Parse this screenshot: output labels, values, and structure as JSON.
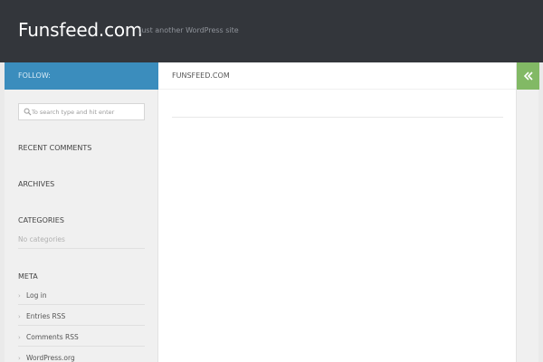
{
  "header": {
    "site_title": "Funsfeed.com",
    "site_description": "Just another WordPress site"
  },
  "sidebar": {
    "follow_label": "FOLLOW:",
    "search": {
      "placeholder": "To search type and hit enter"
    },
    "widgets": {
      "recent_comments": "RECENT COMMENTS",
      "archives": "ARCHIVES",
      "categories": "CATEGORIES",
      "no_categories": "No categories",
      "meta": "META"
    },
    "meta_links": [
      "Log in",
      "Entries RSS",
      "Comments RSS",
      "WordPress.org"
    ]
  },
  "main": {
    "breadcrumb": "FUNSFEED.COM"
  },
  "colors": {
    "header_bg": "#33363b",
    "follow_bar": "#3b8dbd",
    "expand_button": "#82b965",
    "sidebar_bg": "#f0f0f0"
  },
  "icons": {
    "search": "search-icon",
    "expand": "double-chevron-left-icon",
    "meta_bullet": "chevron-right-icon"
  }
}
